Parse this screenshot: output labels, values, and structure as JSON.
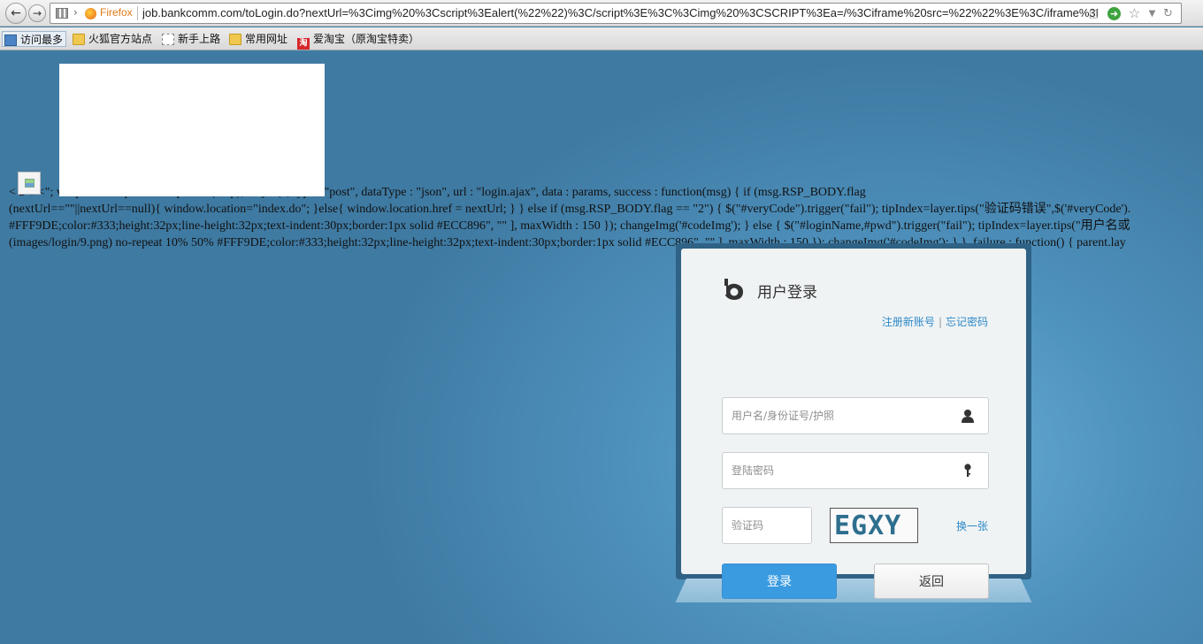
{
  "browser": {
    "brand": "Firefox",
    "url": "job.bankcomm.com/toLogin.do?nextUrl=%3Cimg%20%3Cscript%3Ealert(%22%22)%3C/script%3E%3C%3Cimg%20%3CSCRIPT%3Ea=/%3Ciframe%20src=%22%22%3E%3C/iframe%3E%",
    "back_icon": "back-arrow-icon",
    "forward_icon": "forward-arrow-icon"
  },
  "bookmarks": [
    {
      "label": "访问最多"
    },
    {
      "label": "火狐官方站点"
    },
    {
      "label": "新手上路"
    },
    {
      "label": "常用网址"
    },
    {
      "label": "爱淘宝（原淘宝特卖）",
      "icon_text": "淘"
    }
  ],
  "page": {
    "code_lines": [
      "<               a=/                                                        <\"; var params = paramsMap2Json(map); $.ajax( { type : \"post\", dataType : \"json\", url : \"login.ajax\", data : params, success : function(msg) { if (msg.RSP_BODY.flag",
      "(nextUrl==\"\"||nextUrl==null){ window.location=\"index.do\"; }else{ window.location.href = nextUrl; } } else if (msg.RSP_BODY.flag == \"2\") { $(\"#veryCode\").trigger(\"fail\"); tipIndex=layer.tips(\"验证码错误\",$('#veryCode').",
      "#FFF9DE;color:#333;height:32px;line-height:32px;text-indent:30px;border:1px solid #ECC896\", \"\" ], maxWidth : 150 }); changeImg('#codeImg'); } else { $(\"#loginName,#pwd\").trigger(\"fail\"); tipIndex=layer.tips(\"用户名或",
      "(images/login/9.png) no-repeat 10% 50% #FFF9DE;color:#333;height:32px;line-height:32px;text-indent:30px;border:1px solid #ECC896\", \"\" ], maxWidth : 150 }); changeImg('#codeImg'); } }, failure : function() { parent.lay"
    ]
  },
  "login": {
    "title": "用户登录",
    "register_link": "注册新账号",
    "forgot_link": "忘记密码",
    "username_placeholder": "用户名/身份证号/护照",
    "password_placeholder": "登陆密码",
    "captcha_placeholder": "验证码",
    "captcha_text": "EGXY",
    "swap_link": "换一张",
    "login_button": "登录",
    "back_button": "返回",
    "accent_color": "#3a9be0"
  }
}
